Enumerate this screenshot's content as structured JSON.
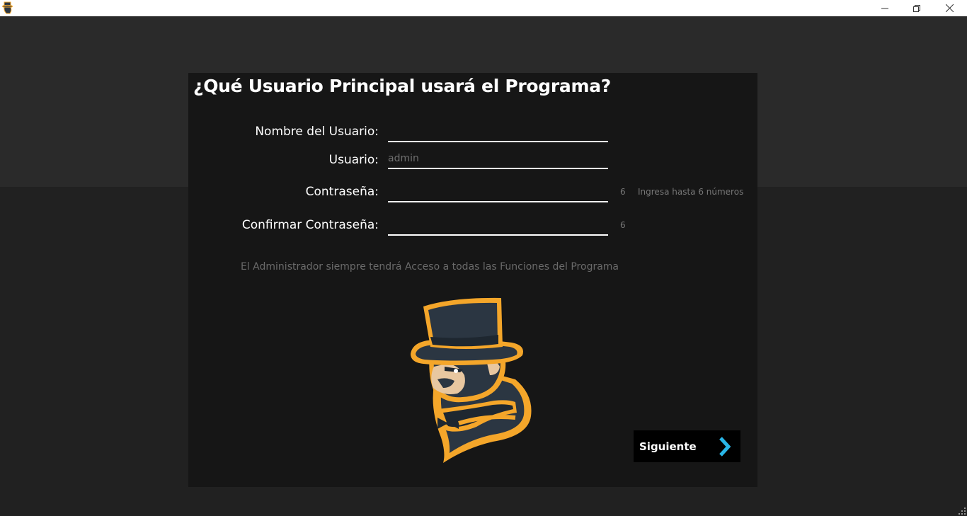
{
  "window": {
    "icon": "gorilla-logo-icon",
    "controls": [
      "minimize-icon",
      "restore-icon",
      "close-icon"
    ]
  },
  "form": {
    "title": "¿Qué Usuario Principal usará el Programa?",
    "fields": [
      {
        "label": "Nombre del Usuario:",
        "value": "",
        "placeholder": ""
      },
      {
        "label": "Usuario:",
        "value": "",
        "placeholder": "admin"
      },
      {
        "label": "Contraseña:",
        "value": "",
        "placeholder": "",
        "counter": "6",
        "hint": "Ingresa hasta 6 números"
      },
      {
        "label": "Confirmar Contraseña:",
        "value": "",
        "placeholder": "",
        "counter": "6"
      }
    ],
    "admin_note": "El Administrador siempre tendrá Acceso a todas las Funciones del Programa",
    "next_button": {
      "label": "Siguiente",
      "icon": "chevron-right-icon"
    }
  },
  "colors": {
    "accent": "#29b6e8",
    "logo_orange": "#f4a62a",
    "logo_dark": "#2b3642"
  }
}
